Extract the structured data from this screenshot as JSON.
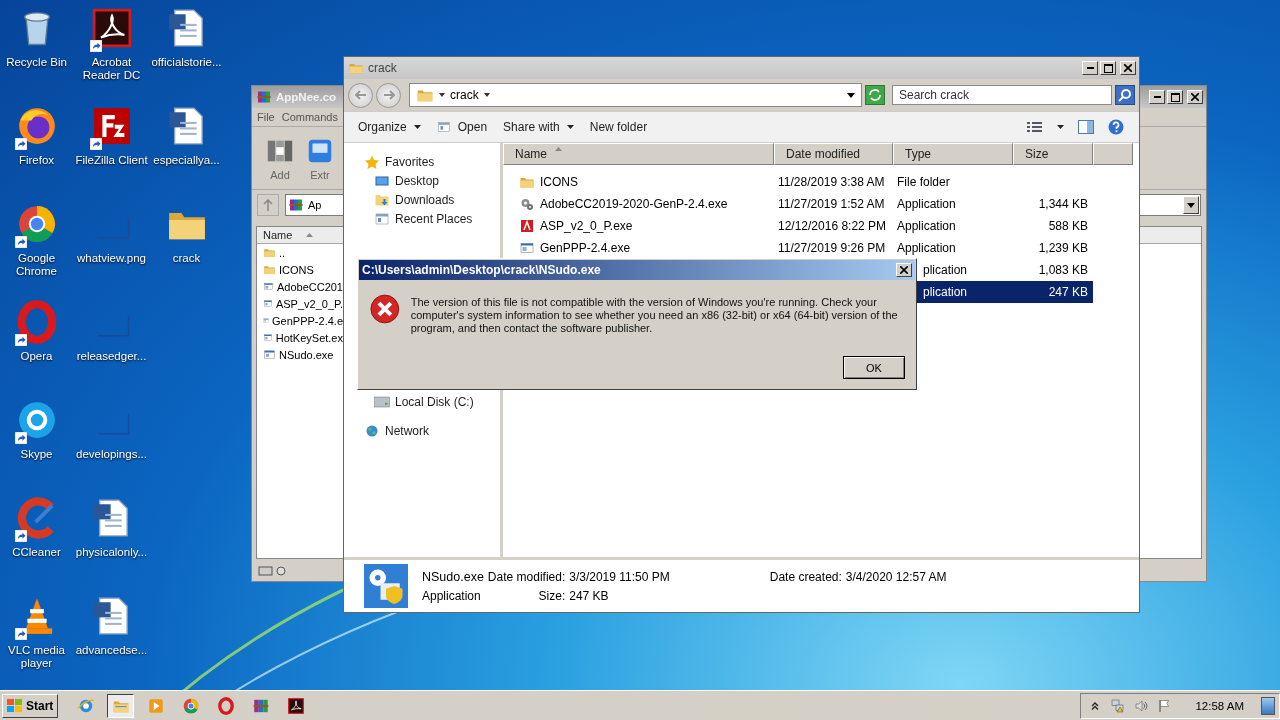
{
  "desktop_icons": [
    {
      "label": "Recycle Bin",
      "kind": "recycle",
      "shortcut": false
    },
    {
      "label": "Firefox",
      "kind": "firefox",
      "shortcut": true
    },
    {
      "label": "Google Chrome",
      "kind": "chrome",
      "shortcut": true
    },
    {
      "label": "Opera",
      "kind": "opera",
      "shortcut": true
    },
    {
      "label": "Skype",
      "kind": "skype",
      "shortcut": true
    },
    {
      "label": "CCleaner",
      "kind": "ccleaner",
      "shortcut": true
    },
    {
      "label": "VLC media player",
      "kind": "vlc",
      "shortcut": true
    },
    {
      "label": "Acrobat Reader DC",
      "kind": "acrobat",
      "shortcut": true
    },
    {
      "label": "FileZilla Client",
      "kind": "filezilla",
      "shortcut": true
    },
    {
      "label": "whatview.png",
      "kind": "blank",
      "shortcut": false
    },
    {
      "label": "releasedger...",
      "kind": "blank",
      "shortcut": false
    },
    {
      "label": "developings...",
      "kind": "blank",
      "shortcut": false
    },
    {
      "label": "physicalonly...",
      "kind": "word",
      "shortcut": false
    },
    {
      "label": "advancedse...",
      "kind": "word",
      "shortcut": false
    },
    {
      "label": "officialstorie...",
      "kind": "word",
      "shortcut": false
    },
    {
      "label": "especiallya...",
      "kind": "word",
      "shortcut": false
    },
    {
      "label": "crack",
      "kind": "folder",
      "shortcut": false
    }
  ],
  "archiver_window": {
    "title": "AppNee.co",
    "menu": [
      "File",
      "Commands"
    ],
    "toolbar": [
      {
        "label": "Add",
        "kind": "add"
      },
      {
        "label": "Extr",
        "kind": "extract"
      }
    ],
    "path": "Ap",
    "column": "Name",
    "files": [
      {
        "name": "..",
        "kind": "folder"
      },
      {
        "name": "ICONS",
        "kind": "folder"
      },
      {
        "name": "AdobeCC201",
        "kind": "exe"
      },
      {
        "name": "ASP_v2_0_P.",
        "kind": "exe"
      },
      {
        "name": "GenPPP-2.4.e",
        "kind": "exe"
      },
      {
        "name": "HotKeySet.ex",
        "kind": "exe"
      },
      {
        "name": "NSudo.exe",
        "kind": "exe"
      }
    ]
  },
  "explorer_window": {
    "title": "crack",
    "breadcrumb": "crack",
    "search": {
      "placeholder": "Search crack"
    },
    "toolbar": [
      {
        "label": "Organize",
        "kind": "menu"
      },
      {
        "label": "Open",
        "kind": "open"
      },
      {
        "label": "Share with",
        "kind": "menu"
      },
      {
        "label": "New folder",
        "kind": "plain"
      }
    ],
    "nav": [
      {
        "label": "Favorites",
        "kind": "star",
        "children": [
          {
            "label": "Desktop",
            "kind": "desktop"
          },
          {
            "label": "Downloads",
            "kind": "downloads"
          },
          {
            "label": "Recent Places",
            "kind": "recent"
          }
        ]
      },
      {
        "label": "Local Disk (C:)",
        "kind": "disk"
      },
      {
        "label": "Network",
        "kind": "network"
      }
    ],
    "columns": [
      {
        "label": "Name",
        "sorted": true
      },
      {
        "label": "Date modified",
        "sorted": false
      },
      {
        "label": "Type",
        "sorted": false
      },
      {
        "label": "Size",
        "sorted": false
      }
    ],
    "files": [
      {
        "name": "ICONS",
        "kind": "folder",
        "date": "11/28/2019 3:38 AM",
        "type": "File folder",
        "selected": false
      },
      {
        "name": "AdobeCC2019-2020-GenP-2.4.exe",
        "kind": "setup",
        "date": "11/27/2019 1:52 AM",
        "type": "Application",
        "size": "1,344 KB",
        "selected": false
      },
      {
        "name": "ASP_v2_0_P.exe",
        "kind": "adobe",
        "date": "12/12/2016 8:22 PM",
        "type": "Application",
        "size": "588 KB",
        "selected": false
      },
      {
        "name": "GenPPP-2.4.exe",
        "kind": "exe",
        "date": "11/27/2019 9:26 PM",
        "type": "Application",
        "size": "1,239 KB",
        "selected": false
      },
      {
        "type": "plication",
        "size": "1,083 KB",
        "selected": false
      },
      {
        "type": "plication",
        "size": "247 KB",
        "selected": true
      }
    ],
    "details": {
      "name": "NSudo.exe",
      "type": "Application",
      "fields": [
        {
          "label": "Date modified:",
          "value": "3/3/2019 11:50 PM"
        },
        {
          "label": "Date created:",
          "value": "3/4/2020 12:57 AM"
        },
        {
          "label": "Size:",
          "value": "247 KB"
        }
      ]
    }
  },
  "dialog": {
    "title": "C:\\Users\\admin\\Desktop\\crack\\NSudo.exe",
    "message": "The version of this file is not compatible with the version of Windows you're running. Check your computer's system information to see whether you need an x86 (32-bit) or x64 (64-bit) version of the program, and then contact the software publisher.",
    "buttons": [
      "OK"
    ]
  },
  "taskbar": {
    "start": "Start",
    "apps": [
      {
        "kind": "ie",
        "active": false
      },
      {
        "kind": "explorer",
        "active": true
      },
      {
        "kind": "media",
        "active": false
      },
      {
        "kind": "chrome",
        "active": false
      },
      {
        "kind": "opera",
        "active": false
      },
      {
        "kind": "winrar",
        "active": false
      },
      {
        "kind": "acrobat",
        "active": false
      }
    ],
    "tray": [
      {
        "kind": "chevron"
      },
      {
        "kind": "network"
      },
      {
        "kind": "speaker"
      },
      {
        "kind": "flag"
      }
    ],
    "clock": "12:58 AM"
  }
}
